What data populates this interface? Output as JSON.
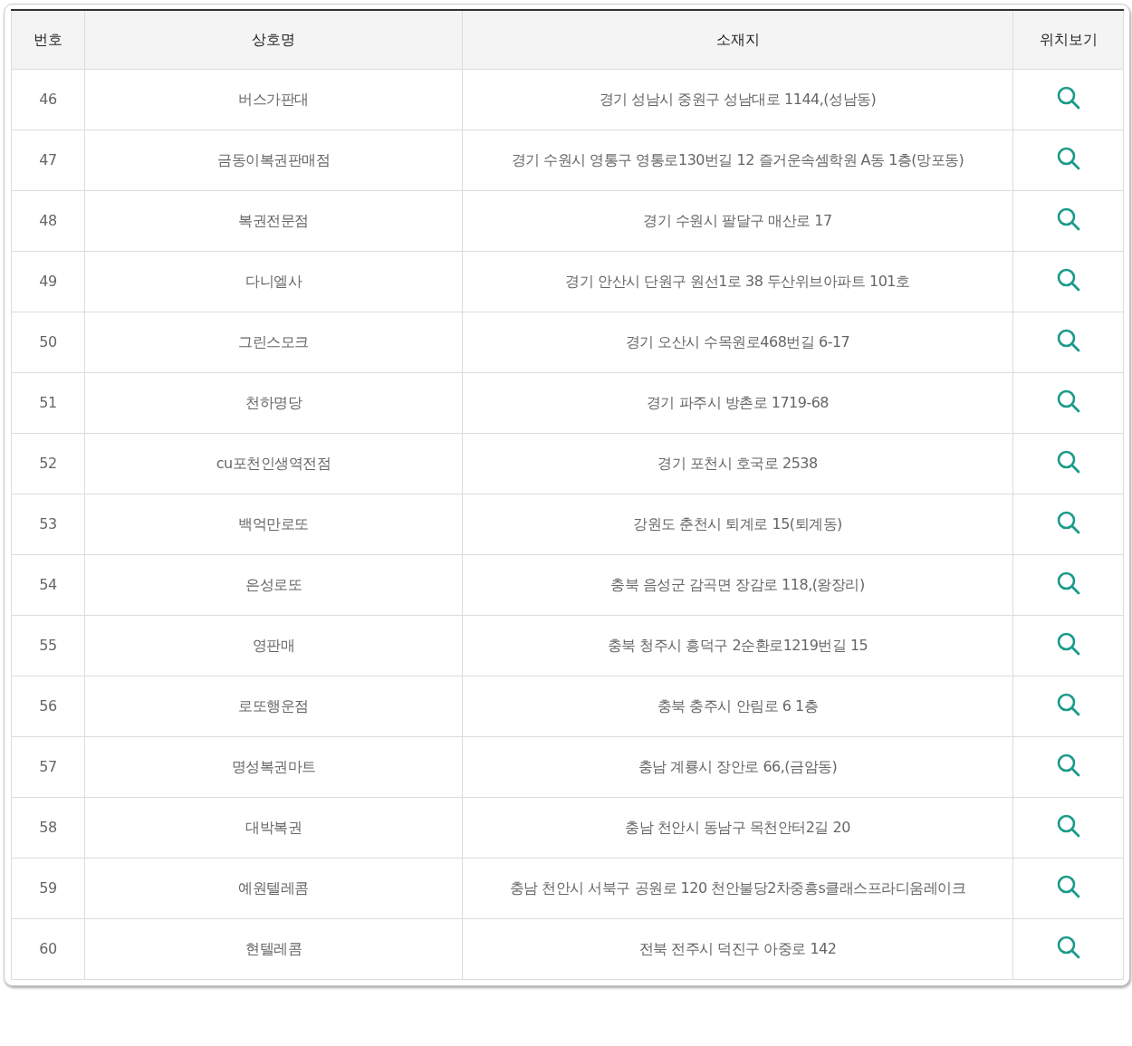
{
  "table": {
    "columns": [
      "번호",
      "상호명",
      "소재지",
      "위치보기"
    ],
    "rows": [
      {
        "number": "46",
        "name": "버스가판대",
        "address": "경기 성남시 중원구 성남대로 1144,(성남동)"
      },
      {
        "number": "47",
        "name": "금동이복권판매점",
        "address": "경기 수원시 영통구 영통로130번길 12 즐거운속셈학원 A동 1층(망포동)"
      },
      {
        "number": "48",
        "name": "복권전문점",
        "address": "경기 수원시 팔달구 매산로 17"
      },
      {
        "number": "49",
        "name": "다니엘사",
        "address": "경기 안산시 단원구 원선1로 38 두산위브아파트 101호"
      },
      {
        "number": "50",
        "name": "그린스모크",
        "address": "경기 오산시 수목원로468번길 6-17"
      },
      {
        "number": "51",
        "name": "천하명당",
        "address": "경기 파주시 방촌로 1719-68"
      },
      {
        "number": "52",
        "name": "cu포천인생역전점",
        "address": "경기 포천시 호국로 2538"
      },
      {
        "number": "53",
        "name": "백억만로또",
        "address": "강원도 춘천시 퇴계로 15(퇴계동)"
      },
      {
        "number": "54",
        "name": "은성로또",
        "address": "충북 음성군 감곡면 장감로 118,(왕장리)"
      },
      {
        "number": "55",
        "name": "영판매",
        "address": "충북 청주시 흥덕구 2순환로1219번길 15"
      },
      {
        "number": "56",
        "name": "로또행운점",
        "address": "충북 충주시 안림로 6 1층"
      },
      {
        "number": "57",
        "name": "명성복권마트",
        "address": "충남 계룡시 장안로 66,(금암동)"
      },
      {
        "number": "58",
        "name": "대박복권",
        "address": "충남 천안시 동남구 목천안터2길 20"
      },
      {
        "number": "59",
        "name": "예원텔레콤",
        "address": "충남 천안시 서북구 공원로 120 천안불당2차중흥s클래스프라디움레이크"
      },
      {
        "number": "60",
        "name": "현텔레콤",
        "address": "전북 전주시 덕진구 아중로 142"
      }
    ]
  }
}
